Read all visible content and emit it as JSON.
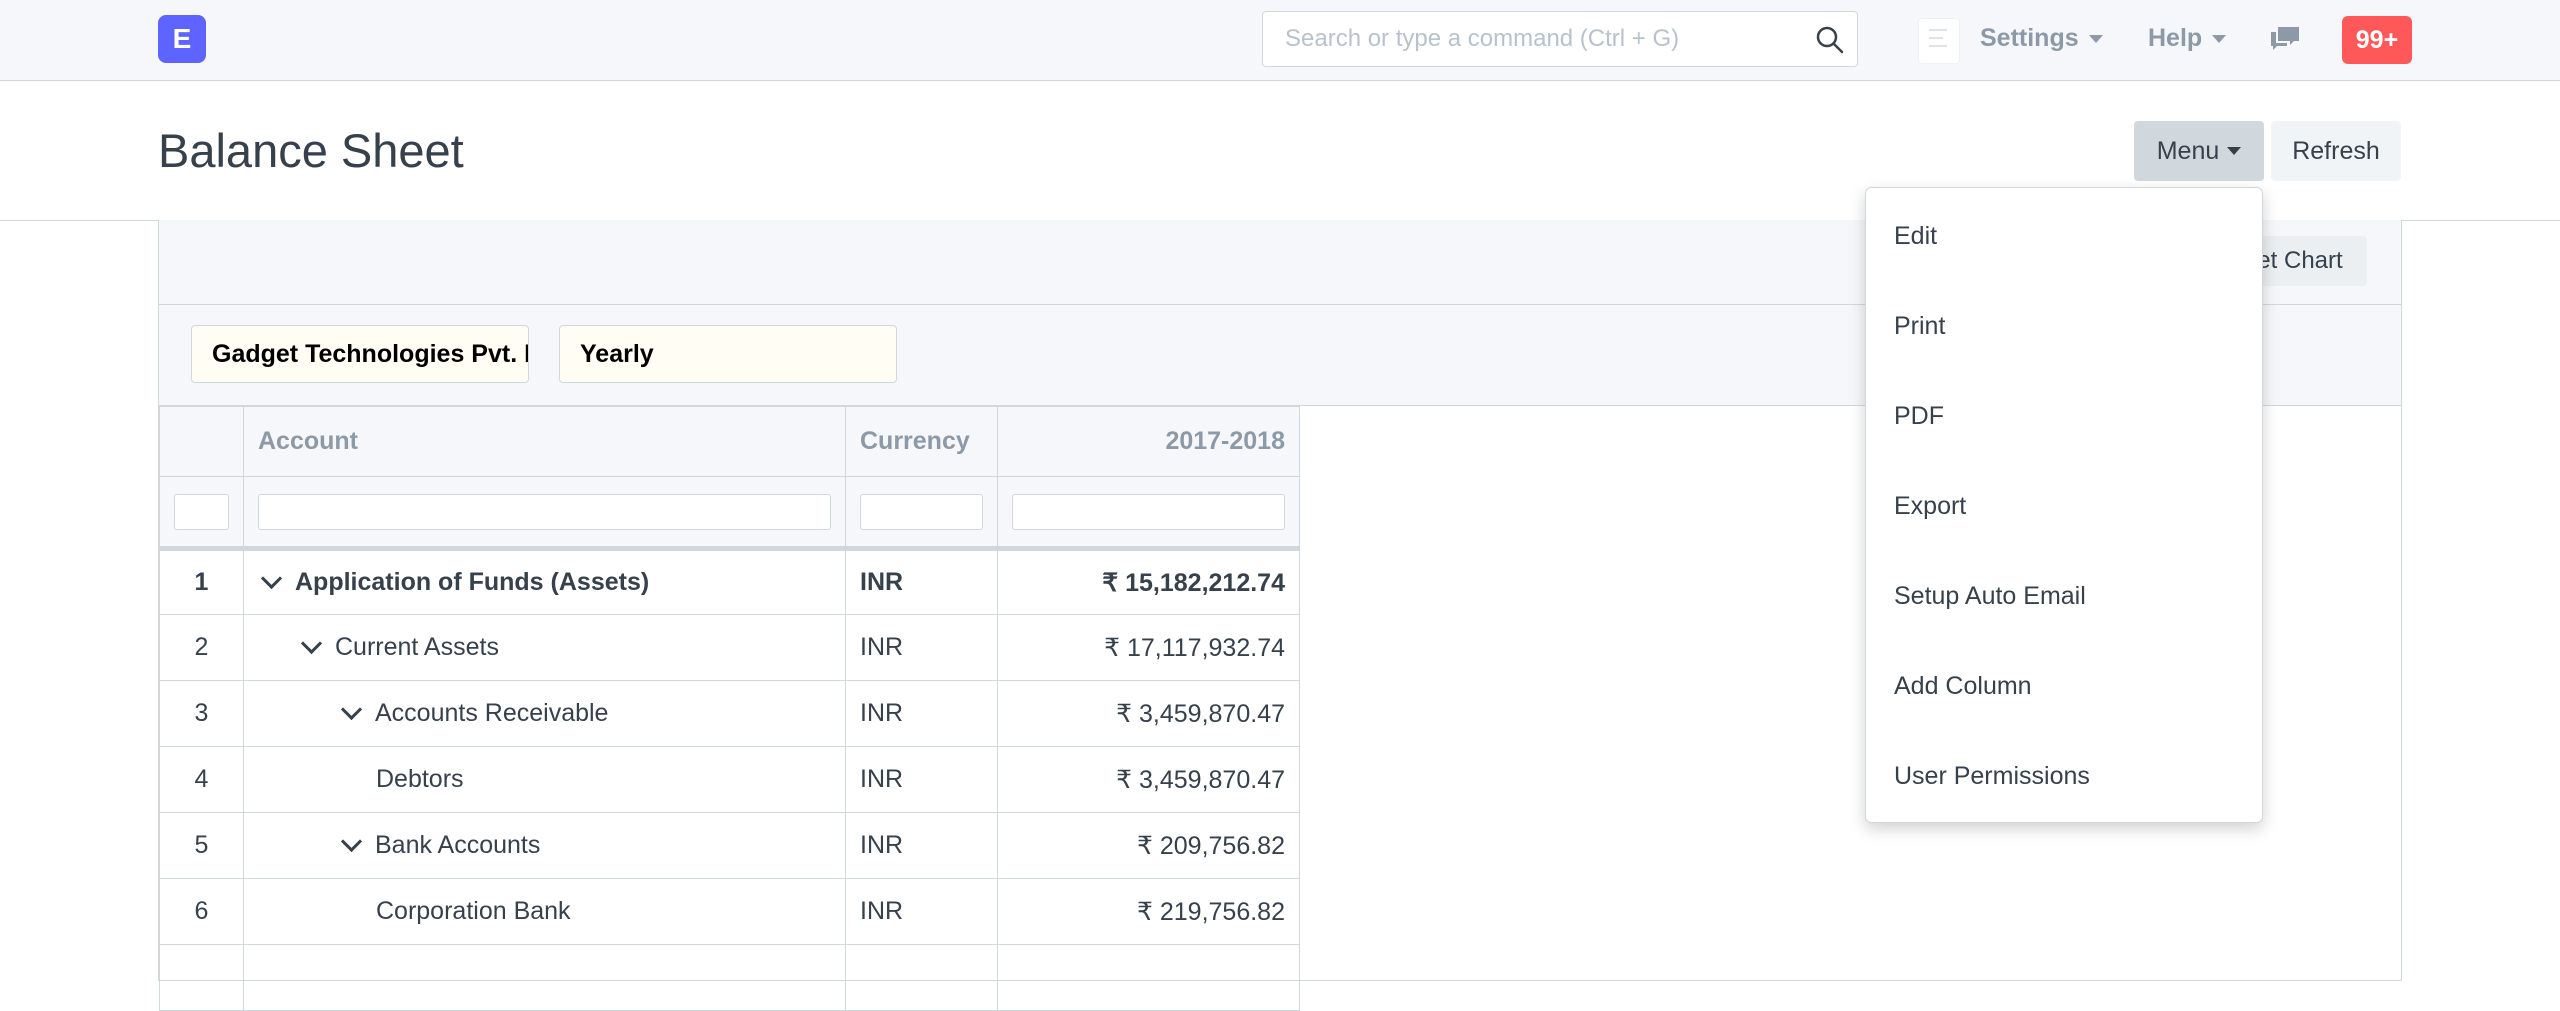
{
  "navbar": {
    "logo_letter": "E",
    "search_placeholder": "Search or type a command (Ctrl + G)",
    "settings_label": "Settings",
    "help_label": "Help",
    "notification_count": "99+"
  },
  "page": {
    "title": "Balance Sheet",
    "menu_label": "Menu",
    "refresh_label": "Refresh"
  },
  "toolbar": {
    "set_chart_label": "Set Chart"
  },
  "filters": {
    "company": "Gadget Technologies Pvt. Ltd.",
    "periodicity": "Yearly"
  },
  "table": {
    "columns": [
      "",
      "Account",
      "Currency",
      "2017-2018"
    ],
    "rows": [
      {
        "num": "1",
        "account": "Application of Funds (Assets)",
        "currency": "INR",
        "amount": "₹ 15,182,212.74"
      },
      {
        "num": "2",
        "account": "Current Assets",
        "currency": "INR",
        "amount": "₹ 17,117,932.74"
      },
      {
        "num": "3",
        "account": "Accounts Receivable",
        "currency": "INR",
        "amount": "₹ 3,459,870.47"
      },
      {
        "num": "4",
        "account": "Debtors",
        "currency": "INR",
        "amount": "₹ 3,459,870.47"
      },
      {
        "num": "5",
        "account": "Bank Accounts",
        "currency": "INR",
        "amount": "₹ 209,756.82"
      },
      {
        "num": "6",
        "account": "Corporation Bank",
        "currency": "INR",
        "amount": "₹ 219,756.82"
      }
    ]
  },
  "menu": {
    "items": [
      "Edit",
      "Print",
      "PDF",
      "Export",
      "Setup Auto Email",
      "Add Column",
      "User Permissions"
    ]
  }
}
